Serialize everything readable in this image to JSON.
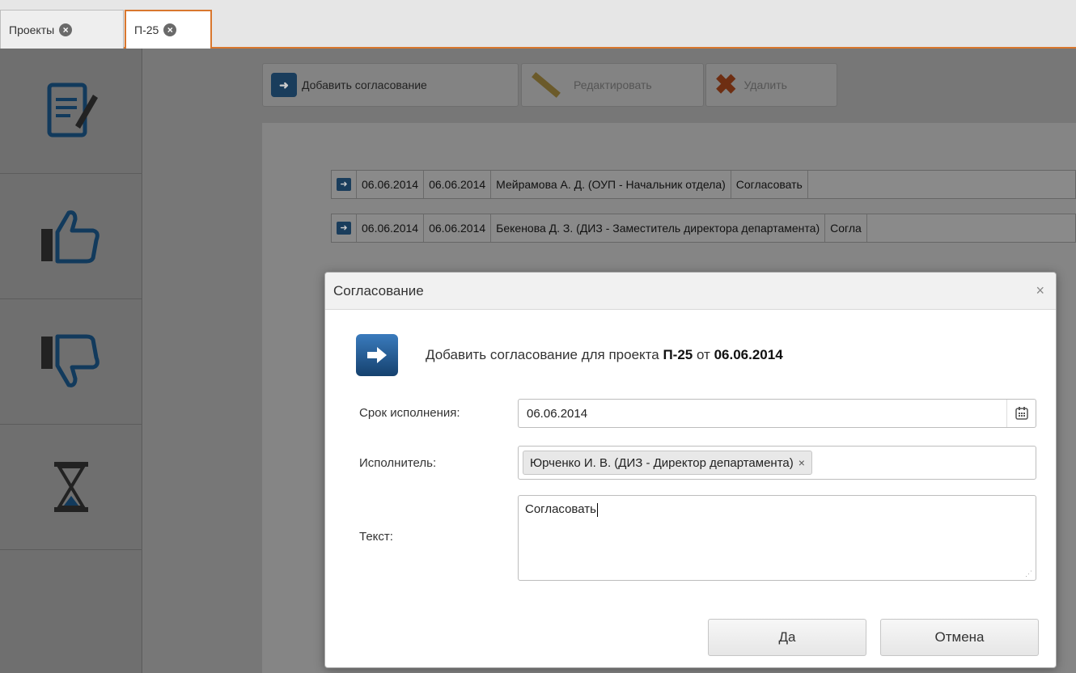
{
  "tabs": [
    {
      "label": "Проекты",
      "active": false
    },
    {
      "label": "П-25",
      "active": true
    }
  ],
  "sidebar": {
    "items": [
      {
        "icon": "document-sign-icon"
      },
      {
        "icon": "thumbs-up-icon"
      },
      {
        "icon": "thumbs-down-icon"
      },
      {
        "icon": "hourglass-icon"
      }
    ]
  },
  "toolbar": {
    "add_label": "Добавить согласование",
    "edit_label": "Редактировать",
    "delete_label": "Удалить"
  },
  "grid": {
    "rows": [
      {
        "date1": "06.06.2014",
        "date2": "06.06.2014",
        "person": "Мейрамова А. Д. (ОУП - Начальник отдела)",
        "text": "Согласовать"
      },
      {
        "date1": "06.06.2014",
        "date2": "06.06.2014",
        "person": "Бекенова Д. З. (ДИЗ - Заместитель директора департамента)",
        "text": "Согла"
      }
    ]
  },
  "dialog": {
    "title": "Согласование",
    "close_glyph": "×",
    "intro_prefix": "Добавить согласование для проекта ",
    "project": "П-25",
    "intro_mid": " от ",
    "date": "06.06.2014",
    "deadline_label": "Срок исполнения:",
    "deadline_value": "06.06.2014",
    "executor_label": "Исполнитель:",
    "executor_tag": "Юрченко И. В. (ДИЗ - Директор департамента)",
    "executor_remove": "×",
    "text_label": "Текст:",
    "text_value": "Согласовать",
    "ok_label": "Да",
    "cancel_label": "Отмена"
  },
  "colors": {
    "accent": "#d9772e",
    "icon_blue": "#1f6fb2"
  }
}
